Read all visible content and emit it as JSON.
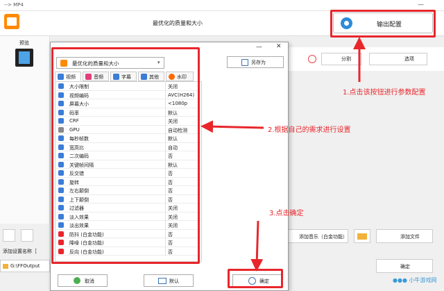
{
  "main_window": {
    "title": "--> MP4",
    "minimize": "—",
    "header_title": "最优化的质量和大小",
    "output_button": "输出配置",
    "preview_label": "预览",
    "split_button": "分割",
    "options_button": "选项",
    "add_music_button": "添加音乐（白金功能）",
    "add_file_button": "添加文件",
    "add_setting_name": "添加设置名称［",
    "output_path": "G:\\FFOutput",
    "ok_button": "确定"
  },
  "dialog": {
    "minimize": "—",
    "close": "✕",
    "profile": "最优化的质量和大小",
    "save_as": "另存为",
    "tabs": [
      {
        "label": "视频",
        "color": "#3b7dd8"
      },
      {
        "label": "音频",
        "color": "#e0407b"
      },
      {
        "label": "字幕",
        "color": "#3b7dd8"
      },
      {
        "label": "其他",
        "color": "#3b7dd8"
      },
      {
        "label": "水印",
        "color": "#ff6a00"
      }
    ],
    "settings": [
      {
        "label": "大小限制",
        "value": "关闭",
        "color": "#3b7dd8"
      },
      {
        "label": "视频编码",
        "value": "AVC(H264)",
        "color": "#3b7dd8"
      },
      {
        "label": "屏幕大小",
        "value": "<1080p",
        "color": "#3b7dd8"
      },
      {
        "label": "码率",
        "value": "默认",
        "color": "#3b7dd8"
      },
      {
        "label": "CRF",
        "value": "关闭",
        "color": "#3b7dd8"
      },
      {
        "label": "GPU",
        "value": "自动检测",
        "color": "#888888"
      },
      {
        "label": "每秒帧数",
        "value": "默认",
        "color": "#3b7dd8"
      },
      {
        "label": "宽高比",
        "value": "自动",
        "color": "#3b7dd8"
      },
      {
        "label": "二次编码",
        "value": "否",
        "color": "#3b7dd8"
      },
      {
        "label": "关键帧间隔",
        "value": "默认",
        "color": "#3b7dd8"
      },
      {
        "label": "反交错",
        "value": "否",
        "color": "#3b7dd8"
      },
      {
        "label": "旋转",
        "value": "否",
        "color": "#3b7dd8"
      },
      {
        "label": "左右颠倒",
        "value": "否",
        "color": "#3b7dd8"
      },
      {
        "label": "上下颠倒",
        "value": "否",
        "color": "#3b7dd8"
      },
      {
        "label": "过滤器",
        "value": "关闭",
        "color": "#3b7dd8"
      },
      {
        "label": "淡入效果",
        "value": "关闭",
        "color": "#3b7dd8"
      },
      {
        "label": "淡出效果",
        "value": "关闭",
        "color": "#3b7dd8"
      },
      {
        "label": "防抖 (白金功能)",
        "value": "否",
        "color": "#e8262b"
      },
      {
        "label": "降噪 (白金功能)",
        "value": "否",
        "color": "#e8262b"
      },
      {
        "label": "反向 (白金功能)",
        "value": "否",
        "color": "#e8262b"
      }
    ],
    "cancel_button": "取消",
    "default_button": "默认",
    "ok_button": "确定"
  },
  "annotations": {
    "step1": "1.点击该按钮进行参数配置",
    "step2": "2.根据自己的需求进行设置",
    "step3": "3.点击确定",
    "color": "#e8262b"
  },
  "watermark": "●●● 小牛游戏网"
}
